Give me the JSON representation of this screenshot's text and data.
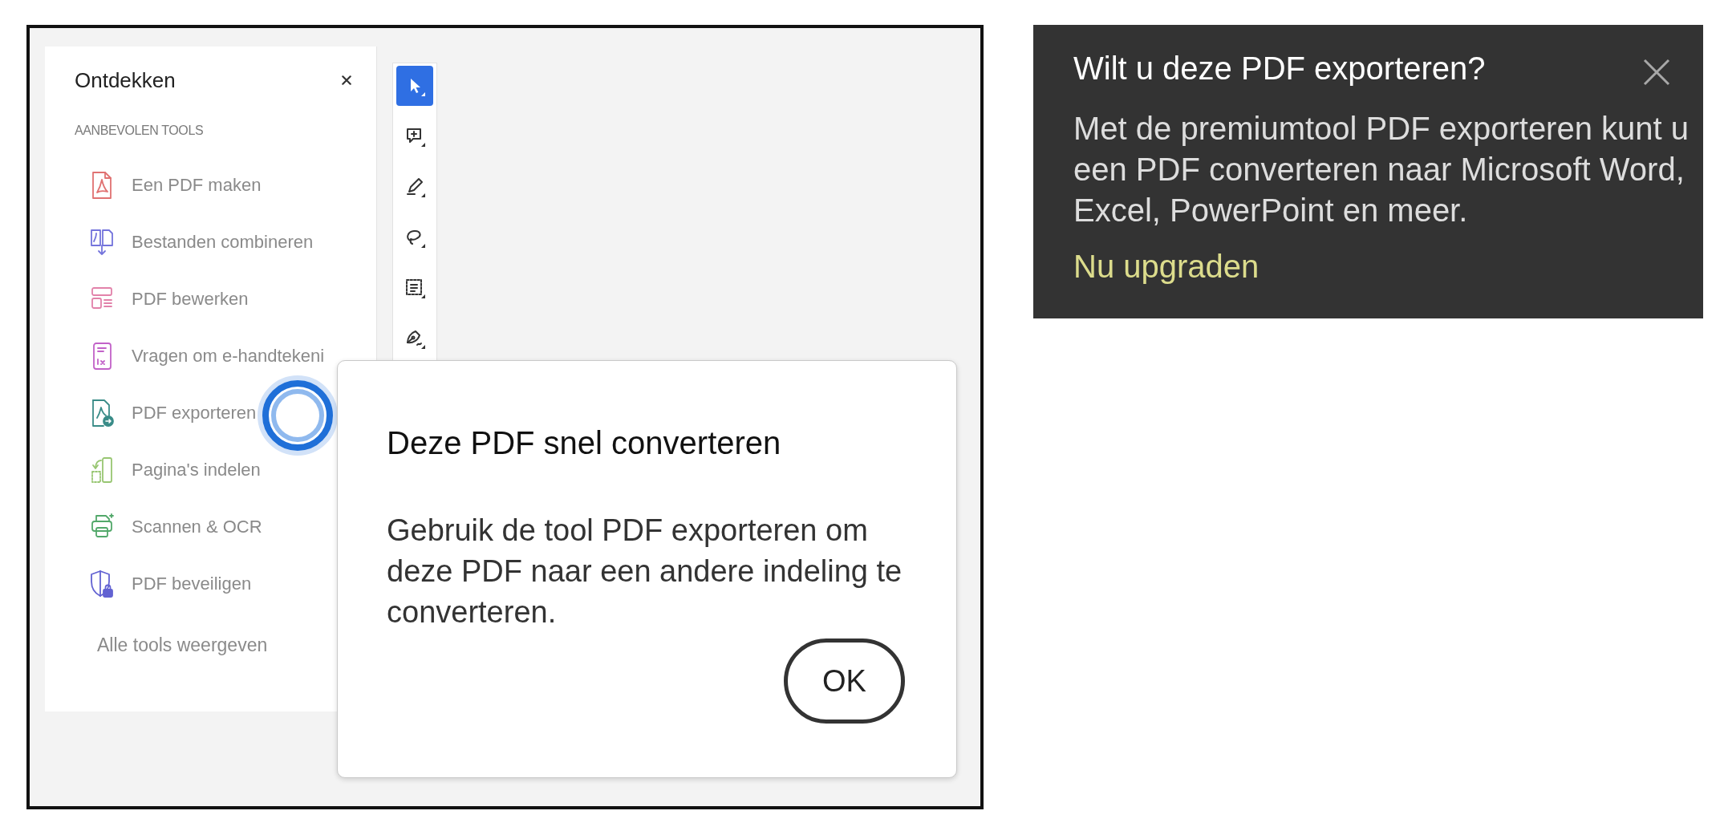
{
  "screenshot": {
    "tools_panel": {
      "title": "Ontdekken",
      "section_heading": "AANBEVOLEN TOOLS",
      "tools": [
        {
          "label": "Een PDF maken",
          "color": "#e07272"
        },
        {
          "label": "Bestanden combineren",
          "color": "#7474dc"
        },
        {
          "label": "PDF bewerken",
          "color": "#e282aa"
        },
        {
          "label": "Vragen om e-handtekeni",
          "color": "#c262c8"
        },
        {
          "label": "PDF exporteren",
          "color": "#3a8c88"
        },
        {
          "label": "Pagina's indelen",
          "color": "#98c672"
        },
        {
          "label": "Scannen & OCR",
          "color": "#52a86a"
        },
        {
          "label": "PDF beveiligen",
          "color": "#6262d2"
        }
      ],
      "all_tools_link": "Alle tools weergeven"
    },
    "toolbar": {
      "tools": [
        {
          "selected": true
        },
        {
          "selected": false
        },
        {
          "selected": false
        },
        {
          "selected": false
        },
        {
          "selected": false
        },
        {
          "selected": false
        }
      ]
    },
    "dialog": {
      "title": "Deze PDF snel converteren",
      "message": "Gebruik de tool PDF exporteren om deze PDF naar een andere indeling te converteren.",
      "button": "OK"
    }
  },
  "callout": {
    "title": "Wilt u deze PDF exporteren?",
    "message": "Met de premiumtool PDF exporteren kunt u een PDF converteren naar Microsoft Word, Excel, PowerPoint en meer.",
    "link": "Nu upgraden"
  }
}
